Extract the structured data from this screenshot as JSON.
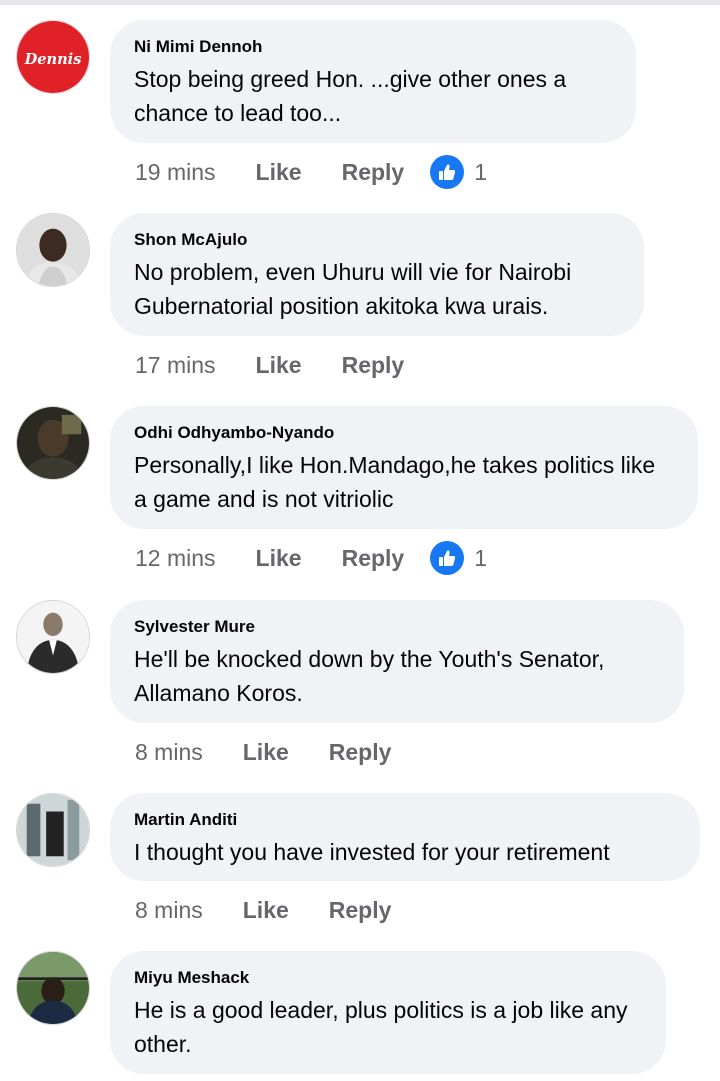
{
  "comments": [
    {
      "author": "Ni Mimi Dennoh",
      "text": "Stop being greed Hon. ...give other ones a chance to lead too...",
      "time": "19 mins",
      "like_label": "Like",
      "reply_label": "Reply",
      "reaction_count": "1",
      "avatar_text": "Dennis"
    },
    {
      "author": "Shon McAjulo",
      "text": "No problem, even Uhuru will vie for Nairobi Gubernatorial position akitoka kwa urais.",
      "time": "17 mins",
      "like_label": "Like",
      "reply_label": "Reply"
    },
    {
      "author": "Odhi Odhyambo-Nyando",
      "text": "Personally,I like Hon.Mandago,he takes politics like a game and is not vitriolic",
      "time": "12 mins",
      "like_label": "Like",
      "reply_label": "Reply",
      "reaction_count": "1"
    },
    {
      "author": "Sylvester Mure",
      "text": "He'll be knocked down by the Youth's Senator, Allamano Koros.",
      "time": "8 mins",
      "like_label": "Like",
      "reply_label": "Reply"
    },
    {
      "author": "Martin Anditi",
      "text": "I thought you have invested for your retirement",
      "time": "8 mins",
      "like_label": "Like",
      "reply_label": "Reply"
    },
    {
      "author": "Miyu Meshack",
      "text": "He is a good leader, plus politics is a job like any other."
    }
  ],
  "icons": {
    "reaction": "thumbs-up-icon"
  },
  "colors": {
    "accent": "#1877f2",
    "bubble": "#f0f2f5",
    "meta": "#65676b"
  }
}
